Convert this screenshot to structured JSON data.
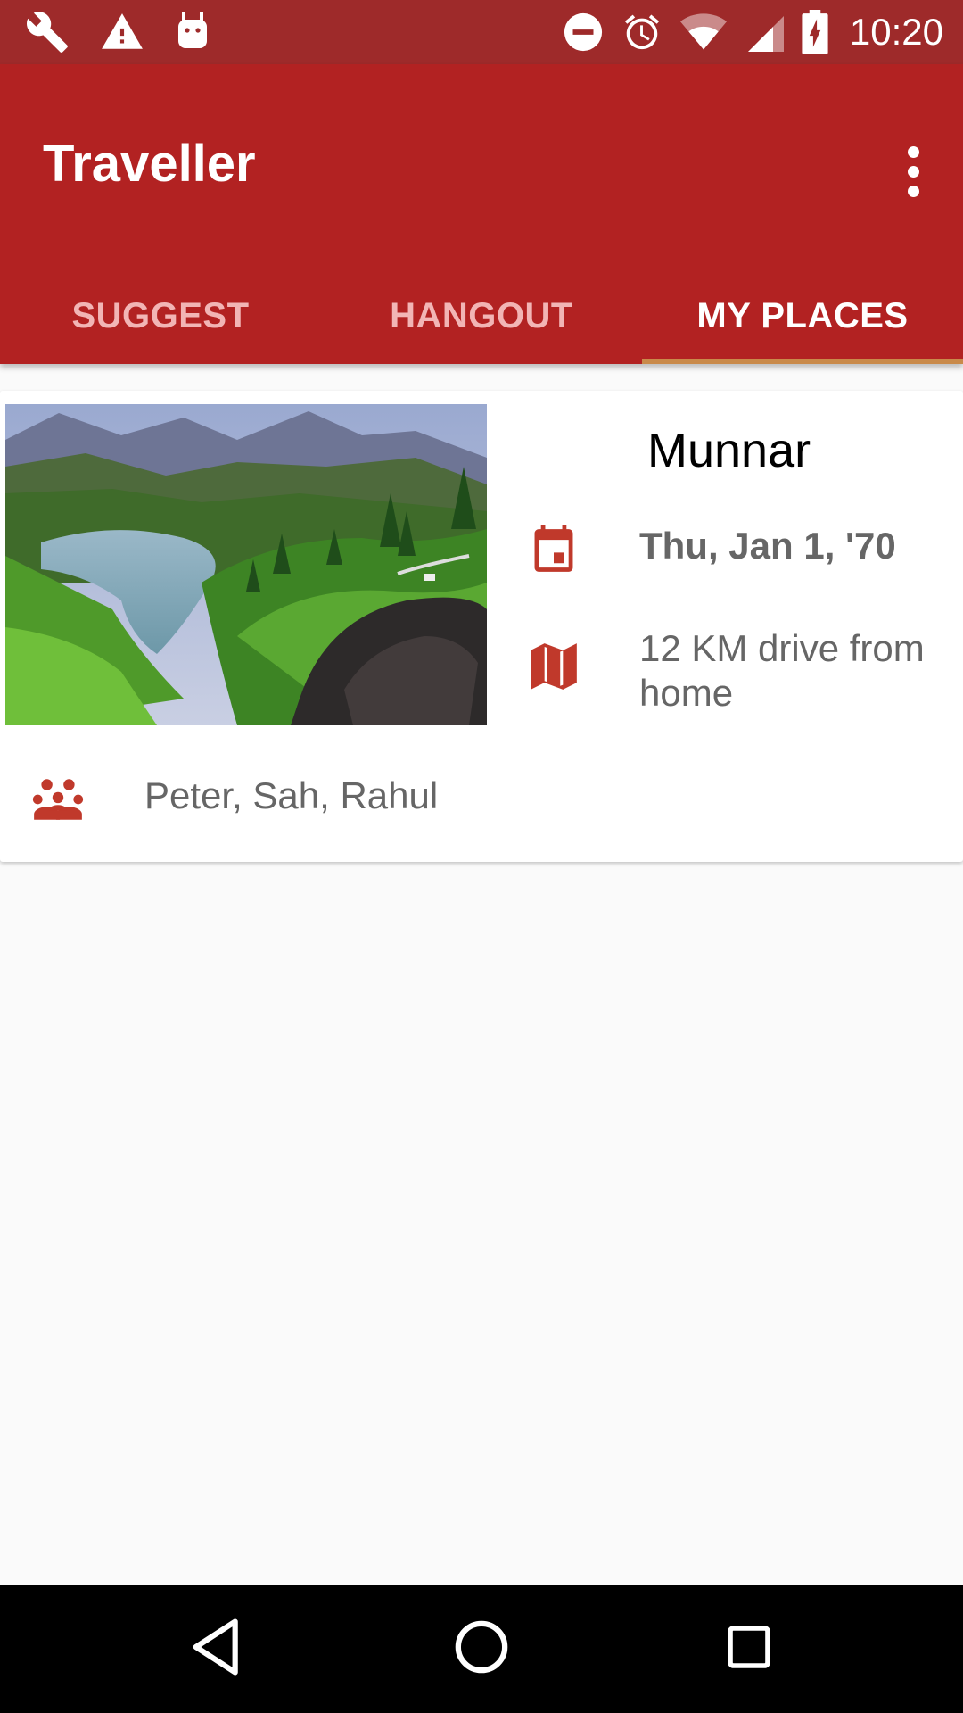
{
  "status_bar": {
    "time": "10:20",
    "left_icons": [
      "wrench-icon",
      "warning-icon",
      "android-debug-icon"
    ],
    "right_icons": [
      "do-not-disturb-icon",
      "alarm-icon",
      "wifi-icon",
      "cell-signal-icon",
      "battery-charging-icon"
    ]
  },
  "app_bar": {
    "title": "Traveller",
    "overflow_icon": "more-vert-icon"
  },
  "tabs": [
    {
      "label": "SUGGEST",
      "active": false
    },
    {
      "label": "HANGOUT",
      "active": false
    },
    {
      "label": "MY PLACES",
      "active": true
    }
  ],
  "place_card": {
    "name": "Munnar",
    "date": "Thu, Jan 1, '70",
    "distance": "12 KM drive from home",
    "friends": "Peter, Sah, Rahul",
    "image_icon": "landscape-photo"
  },
  "nav_bar": {
    "buttons": [
      "back-icon",
      "home-icon",
      "recents-icon"
    ]
  },
  "colors": {
    "status_bar": "#9e2a2a",
    "primary": "#b22222",
    "tab_indicator": "#c98a4a",
    "icon_red": "#c0392b",
    "background": "#fafafa"
  }
}
